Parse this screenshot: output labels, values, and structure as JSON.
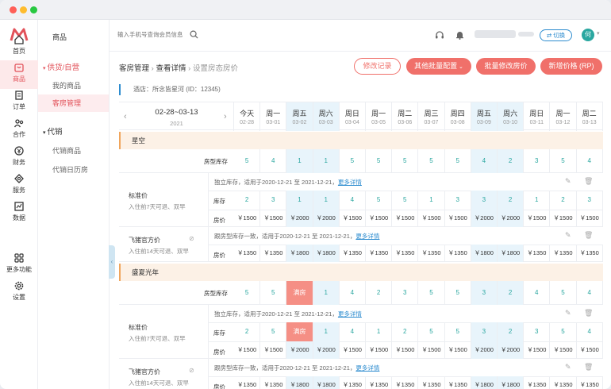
{
  "nav": [
    {
      "label": "首页",
      "icon": "home-icon"
    },
    {
      "label": "商品",
      "icon": "goods-icon",
      "active": true
    },
    {
      "label": "订单",
      "icon": "order-icon"
    },
    {
      "label": "合作",
      "icon": "cooperation-icon"
    },
    {
      "label": "财务",
      "icon": "finance-icon"
    },
    {
      "label": "服务",
      "icon": "service-icon"
    },
    {
      "label": "数据",
      "icon": "data-icon"
    },
    {
      "label": "更多功能",
      "icon": "more-icon"
    },
    {
      "label": "设置",
      "icon": "settings-icon"
    }
  ],
  "submenu": {
    "title": "商品",
    "group1": "供货/自营",
    "group1_items": [
      "我的商品",
      "客房管理"
    ],
    "group2": "代销",
    "group2_items": [
      "代销商品",
      "代销日历房"
    ]
  },
  "topbar": {
    "search_placeholder": "输入手机号查询会员信息",
    "switch_label": "切换",
    "avatar_text": "何"
  },
  "breadcrumb": {
    "a": "客房管理",
    "b": "查看详情",
    "c": "设置房态房价"
  },
  "buttons": {
    "log": "修改记录",
    "other_batch": "其他批量配置",
    "batch_price": "批量修改房价",
    "add_price": "新增价格 (RP)"
  },
  "hotel": {
    "label": "酒店：",
    "name": "所念皆星河 (ID：12345)"
  },
  "range": {
    "dates": "02-28~03-13",
    "year": "2021"
  },
  "days": [
    {
      "w": "今天",
      "d": "02-28"
    },
    {
      "w": "周一",
      "d": "03-01"
    },
    {
      "w": "周五",
      "d": "03-02"
    },
    {
      "w": "周六",
      "d": "03-03"
    },
    {
      "w": "周日",
      "d": "03-04"
    },
    {
      "w": "周一",
      "d": "03-05"
    },
    {
      "w": "周二",
      "d": "03-06"
    },
    {
      "w": "周三",
      "d": "03-07"
    },
    {
      "w": "周四",
      "d": "03-08"
    },
    {
      "w": "周五",
      "d": "03-09"
    },
    {
      "w": "周六",
      "d": "03-10"
    },
    {
      "w": "周日",
      "d": "03-11"
    },
    {
      "w": "周一",
      "d": "03-12"
    },
    {
      "w": "周二",
      "d": "03-13"
    }
  ],
  "labels": {
    "room_stock": "房型库存",
    "stock": "库存",
    "price": "房价"
  },
  "rooms": [
    {
      "name": "星空",
      "room_stock": [
        "5",
        "4",
        "1",
        "1",
        "5",
        "5",
        "5",
        "5",
        "5",
        "4",
        "2",
        "3",
        "5",
        "4"
      ],
      "plans": [
        {
          "name": "标准价",
          "sub": "入住前7天可退、双早",
          "note": "独立库存，适用于2020-12-21 至 2021-12-21，",
          "link": "更多详情",
          "stock": [
            "2",
            "3",
            "1",
            "1",
            "4",
            "5",
            "5",
            "1",
            "3",
            "3",
            "2",
            "1",
            "2",
            "3"
          ],
          "price": [
            "￥1500",
            "￥1500",
            "￥2000",
            "￥2000",
            "￥1500",
            "￥1500",
            "￥1500",
            "￥1500",
            "￥1500",
            "￥2000",
            "￥2000",
            "￥1500",
            "￥1500",
            "￥1500"
          ]
        },
        {
          "name": "飞猪官方价",
          "sub": "入住前14天可退、双早",
          "note": "跟房型库存一致，适用于2020-12-21 至 2021-12-21，",
          "link": "更多详情",
          "price": [
            "￥1350",
            "￥1350",
            "￥1800",
            "￥1800",
            "￥1350",
            "￥1350",
            "￥1350",
            "￥1350",
            "￥1350",
            "￥1800",
            "￥1800",
            "￥1350",
            "￥1350",
            "￥1350"
          ]
        }
      ]
    },
    {
      "name": "盛夏光年",
      "room_stock": [
        "5",
        "5",
        "满房",
        "1",
        "4",
        "2",
        "3",
        "5",
        "5",
        "3",
        "2",
        "4",
        "5",
        "4"
      ],
      "plans": [
        {
          "name": "标准价",
          "sub": "入住前7天可退、双早",
          "note": "独立库存，适用于2020-12-21 至 2021-12-21，",
          "link": "更多详情",
          "stock": [
            "2",
            "5",
            "满房",
            "1",
            "4",
            "1",
            "2",
            "5",
            "5",
            "3",
            "2",
            "3",
            "5",
            "4"
          ],
          "price": [
            "￥1500",
            "￥1500",
            "￥2000",
            "￥2000",
            "￥1500",
            "￥1500",
            "￥1500",
            "￥1500",
            "￥1500",
            "￥2000",
            "￥2000",
            "￥1500",
            "￥1500",
            "￥1500"
          ]
        },
        {
          "name": "飞猪官方价",
          "sub": "入住前14天可退、双早",
          "note": "跟房型库存一致，适用于2020-12-21 至 2021-12-21，",
          "link": "更多详情",
          "price": [
            "￥1350",
            "￥1350",
            "￥1800",
            "￥1800",
            "￥1350",
            "￥1350",
            "￥1350",
            "￥1350",
            "￥1350",
            "￥1800",
            "￥1800",
            "￥1350",
            "￥1350",
            "￥1350"
          ]
        }
      ]
    }
  ],
  "colors": {
    "accent": "#e2525a",
    "button": "#f0706a",
    "teal": "#2aa7a0",
    "blue_col": "#e8f4fb",
    "full": "#f58f85"
  }
}
